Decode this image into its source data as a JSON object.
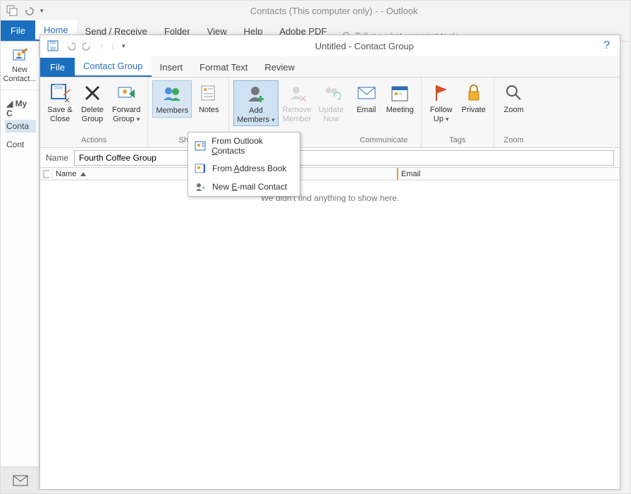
{
  "mainWindow": {
    "title": "Contacts (This computer only) -                             - Outlook",
    "tabs": [
      "File",
      "Home",
      "Send / Receive",
      "Folder",
      "View",
      "Help",
      "Adobe PDF"
    ],
    "tellMe": "Tell me what you want to do"
  },
  "leftPanel": {
    "newContact": {
      "line1": "New",
      "line2": "Contact..."
    },
    "groupHeader": "My C",
    "items": [
      "Conta",
      "Cont"
    ]
  },
  "childWindow": {
    "title": "Untitled  -  Contact Group",
    "tabs": [
      "File",
      "Contact Group",
      "Insert",
      "Format Text",
      "Review"
    ],
    "nameLabel": "Name",
    "nameValue": "Fourth Coffee Group",
    "columns": [
      "Name",
      "Email"
    ],
    "emptyText": "We didn't find anything to show here."
  },
  "ribbon": {
    "actions": {
      "group": "Actions",
      "saveClose": {
        "l1": "Save &",
        "l2": "Close"
      },
      "deleteGroup": {
        "l1": "Delete",
        "l2": "Group"
      },
      "forwardGroup": {
        "l1": "Forward",
        "l2": "Group"
      }
    },
    "show": {
      "group": "Show",
      "members": "Members",
      "notes": "Notes"
    },
    "members": {
      "addMembers": {
        "l1": "Add",
        "l2": "Members"
      },
      "removeMember": {
        "l1": "Remove",
        "l2": "Member"
      },
      "updateNow": {
        "l1": "Update",
        "l2": "Now"
      }
    },
    "communicate": {
      "group": "Communicate",
      "email": "Email",
      "meeting": "Meeting"
    },
    "tags": {
      "group": "Tags",
      "followUp": {
        "l1": "Follow",
        "l2": "Up"
      },
      "private": "Private"
    },
    "zoom": {
      "group": "Zoom",
      "zoom": "Zoom"
    }
  },
  "dropdown": {
    "items": [
      {
        "pre": "From Outlook ",
        "u": "C",
        "post": "ontacts"
      },
      {
        "pre": "From ",
        "u": "A",
        "post": "ddress Book"
      },
      {
        "pre": "New ",
        "u": "E",
        "post": "-mail Contact"
      }
    ]
  }
}
